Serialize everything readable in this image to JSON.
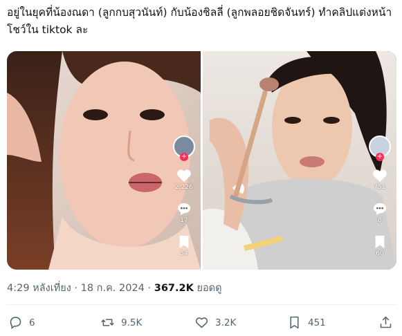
{
  "post": {
    "text": "อยู่ในยุคที่น้องณดา (ลูกกบสุวนันท์) กับน้องชิลลี่ (ลูกพลอยชิดจันทร์) ทำคลิปแต่งหน้าโชว์ใน tiktok ละ",
    "time": "4:29 หลังเที่ยง",
    "date": "18 ก.ค. 2024",
    "views": "367.2K",
    "views_label": "ยอดดู",
    "dot": "·"
  },
  "videos": [
    {
      "likes": "2,226",
      "comments": "17",
      "saves": "54"
    },
    {
      "likes": "751",
      "comments": "8",
      "saves": "60"
    }
  ],
  "actions": {
    "replies": "6",
    "reposts": "9.5K",
    "likes": "3.2K",
    "bookmarks": "451"
  },
  "icons": {
    "reply": "reply-icon",
    "repost": "repost-icon",
    "like": "heart-icon",
    "bookmark": "bookmark-icon",
    "share": "share-icon"
  },
  "colors": {
    "tiktok_red": "#fe2c55",
    "muted": "#536471",
    "text": "#0f1419"
  }
}
